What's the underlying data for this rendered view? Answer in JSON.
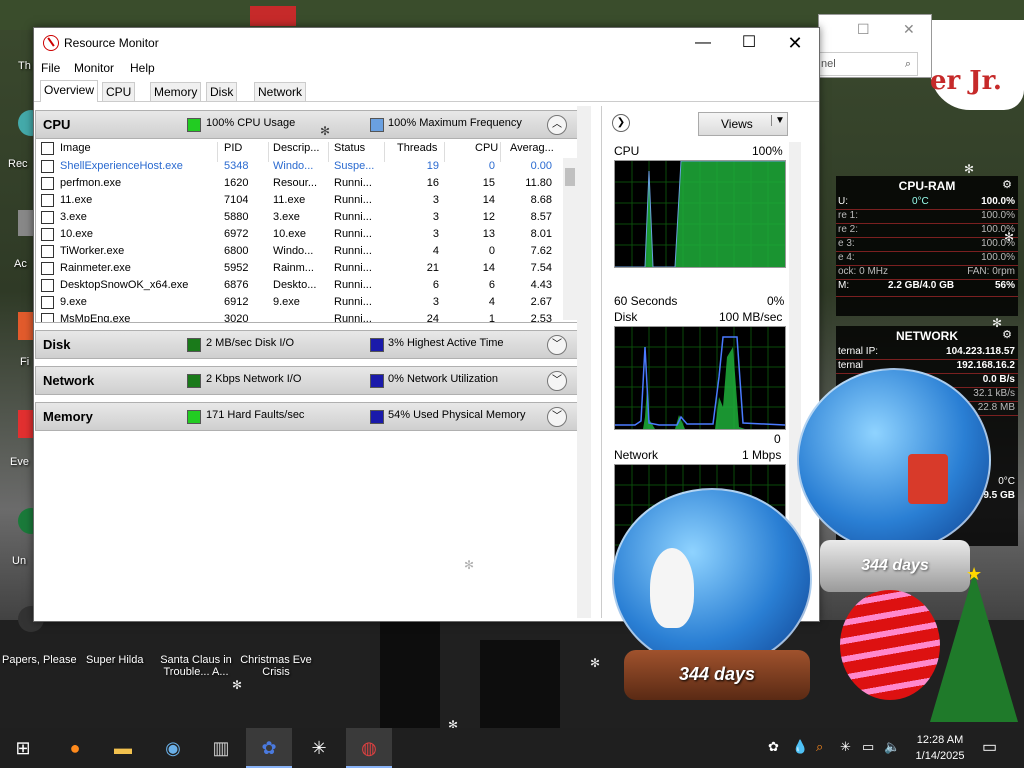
{
  "desktop": {
    "icons": [
      {
        "label": "Th"
      },
      {
        "label": "Rec"
      },
      {
        "label": "Ac"
      },
      {
        "label": "Fi"
      },
      {
        "label": "Eve"
      },
      {
        "label": "Un"
      },
      {
        "label": "Papers, Please"
      },
      {
        "label": "Super Hilda"
      },
      {
        "label": "Santa Claus in Trouble... A..."
      },
      {
        "label": "Christmas Eve Crisis"
      }
    ],
    "bg_text": "er Jr."
  },
  "bg_window": {
    "search_placeholder": "nel"
  },
  "window": {
    "title": "Resource Monitor",
    "menu": [
      "File",
      "Monitor",
      "Help"
    ],
    "tabs": [
      "Overview",
      "CPU",
      "Memory",
      "Disk",
      "Network"
    ],
    "active_tab": "Overview"
  },
  "cpu_section": {
    "name": "CPU",
    "ind1_text": "100% CPU Usage",
    "ind1_color": "#22cc22",
    "ind2_text": "100% Maximum Frequency",
    "ind2_color": "#6aa0e0",
    "columns": [
      "Image",
      "PID",
      "Descrip...",
      "Status",
      "Threads",
      "CPU",
      "Averag..."
    ],
    "rows": [
      {
        "image": "ShellExperienceHost.exe",
        "pid": "5348",
        "desc": "Windo...",
        "status": "Suspe...",
        "threads": "19",
        "cpu": "0",
        "avg": "0.00",
        "suspended": true
      },
      {
        "image": "perfmon.exe",
        "pid": "1620",
        "desc": "Resour...",
        "status": "Runni...",
        "threads": "16",
        "cpu": "15",
        "avg": "11.80"
      },
      {
        "image": "11.exe",
        "pid": "7104",
        "desc": "11.exe",
        "status": "Runni...",
        "threads": "3",
        "cpu": "14",
        "avg": "8.68"
      },
      {
        "image": "3.exe",
        "pid": "5880",
        "desc": "3.exe",
        "status": "Runni...",
        "threads": "3",
        "cpu": "12",
        "avg": "8.57"
      },
      {
        "image": "10.exe",
        "pid": "6972",
        "desc": "10.exe",
        "status": "Runni...",
        "threads": "3",
        "cpu": "13",
        "avg": "8.01"
      },
      {
        "image": "TiWorker.exe",
        "pid": "6800",
        "desc": "Windo...",
        "status": "Runni...",
        "threads": "4",
        "cpu": "0",
        "avg": "7.62"
      },
      {
        "image": "Rainmeter.exe",
        "pid": "5952",
        "desc": "Rainm...",
        "status": "Runni...",
        "threads": "21",
        "cpu": "14",
        "avg": "7.54"
      },
      {
        "image": "DesktopSnowOK_x64.exe",
        "pid": "6876",
        "desc": "Deskto...",
        "status": "Runni...",
        "threads": "6",
        "cpu": "6",
        "avg": "4.43"
      },
      {
        "image": "9.exe",
        "pid": "6912",
        "desc": "9.exe",
        "status": "Runni...",
        "threads": "3",
        "cpu": "4",
        "avg": "2.67"
      },
      {
        "image": "MsMpEng.exe",
        "pid": "3020",
        "desc": "",
        "status": "Runni...",
        "threads": "24",
        "cpu": "1",
        "avg": "2.53"
      }
    ]
  },
  "disk_section": {
    "name": "Disk",
    "ind1_text": "2 MB/sec Disk I/O",
    "ind1_color": "#1a7a1a",
    "ind2_text": "3% Highest Active Time",
    "ind2_color": "#1a1aaa"
  },
  "network_section": {
    "name": "Network",
    "ind1_text": "2 Kbps Network I/O",
    "ind1_color": "#1a7a1a",
    "ind2_text": "0% Network Utilization",
    "ind2_color": "#1a1aaa"
  },
  "memory_section": {
    "name": "Memory",
    "ind1_text": "171 Hard Faults/sec",
    "ind1_color": "#22cc22",
    "ind2_text": "54% Used Physical Memory",
    "ind2_color": "#1a1aaa"
  },
  "right_pane": {
    "views_label": "Views",
    "cpu_graph": {
      "title": "CPU",
      "max": "100%",
      "footer_left": "60 Seconds",
      "footer_right": "0%"
    },
    "disk_graph": {
      "title": "Disk",
      "max": "100 MB/sec",
      "footer_right": "0"
    },
    "network_graph": {
      "title": "Network",
      "max": "1 Mbps"
    }
  },
  "cpu_ram_widget": {
    "title": "CPU-RAM",
    "rows": [
      {
        "label": "U:",
        "mid": "0°C",
        "value": "100.0%"
      },
      {
        "label": "re 1:",
        "mid": "",
        "value": "100.0%"
      },
      {
        "label": "re 2:",
        "mid": "",
        "value": "100.0%"
      },
      {
        "label": "e 3:",
        "mid": "",
        "value": "100.0%"
      },
      {
        "label": "e 4:",
        "mid": "",
        "value": "100.0%"
      },
      {
        "label": "ock: 0 MHz",
        "mid": "",
        "value": "FAN: 0rpm"
      },
      {
        "label": "M:",
        "mid": "2.2 GB/4.0 GB",
        "value": "56%"
      }
    ]
  },
  "network_widget": {
    "title": "NETWORK",
    "rows": [
      {
        "label": "ternal IP:",
        "value": "104.223.118.57"
      },
      {
        "label": "ternal",
        "value": "192.168.16.2"
      },
      {
        "label": "",
        "value": "0.0 B/s"
      },
      {
        "label": "",
        "value": "32.1 kB/s"
      },
      {
        "label": "",
        "value": "22.8 MB"
      }
    ],
    "temp": "0°C",
    "size": "9.5 GB"
  },
  "globes": {
    "days_label": "344 days"
  },
  "taskbar": {
    "time": "12:28 AM",
    "date": "1/14/2025"
  }
}
